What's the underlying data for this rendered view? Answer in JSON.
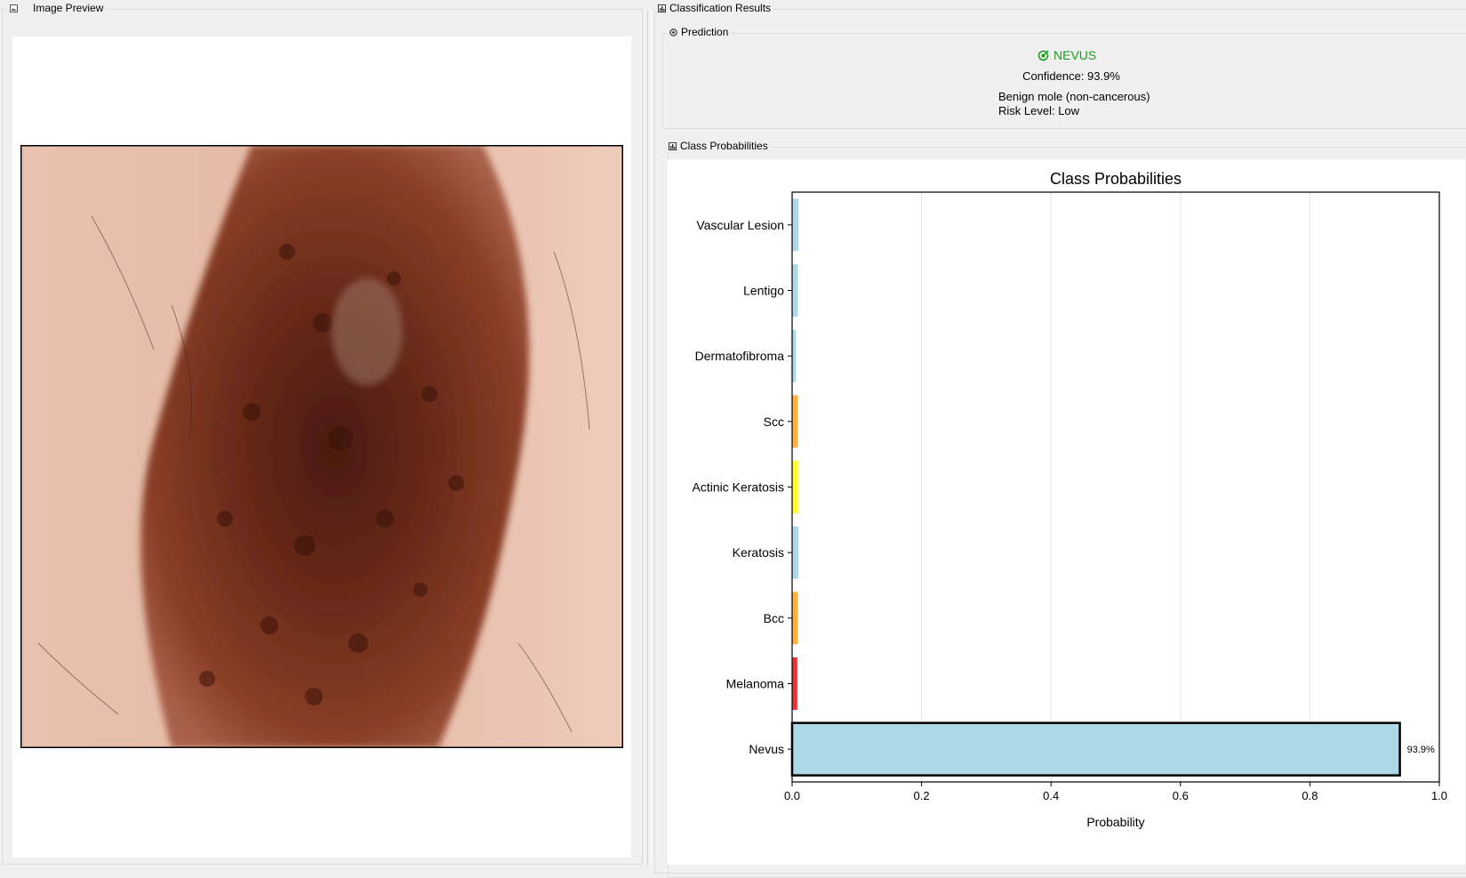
{
  "image_panel": {
    "title": "Image Preview",
    "title_icon": "image-icon"
  },
  "results_panel": {
    "title": "Classification Results",
    "title_icon": "panel-icon",
    "prediction_group": {
      "title": "Prediction",
      "title_icon": "target-icon",
      "class_icon": "target-check-icon",
      "class_name": "NEVUS",
      "class_color": "#1a9c1a",
      "confidence": "Confidence: 93.9%",
      "description": "Benign mole (non-cancerous)",
      "risk": "Risk Level: Low"
    },
    "probabilities_group": {
      "title": "Class Probabilities",
      "title_icon": "chart-icon"
    }
  },
  "chart_data": {
    "type": "bar",
    "orientation": "horizontal",
    "title": "Class Probabilities",
    "xlabel": "Probability",
    "ylabel": "",
    "xlim": [
      0,
      1.0
    ],
    "xticks": [
      "0.0",
      "0.2",
      "0.4",
      "0.6",
      "0.8",
      "1.0"
    ],
    "grid": "vertical",
    "categories": [
      "Nevus",
      "Melanoma",
      "Bcc",
      "Keratosis",
      "Actinic Keratosis",
      "Scc",
      "Dermatofibroma",
      "Lentigo",
      "Vascular Lesion"
    ],
    "values": [
      0.939,
      0.008,
      0.009,
      0.01,
      0.01,
      0.009,
      0.006,
      0.009,
      0.01
    ],
    "colors": [
      "#add8e6",
      "#e8333c",
      "#ffb040",
      "#add8e6",
      "#ffff33",
      "#ffb040",
      "#add8e6",
      "#add8e6",
      "#add8e6"
    ],
    "highlighted": "Nevus",
    "value_labels": [
      {
        "category": "Nevus",
        "text": "93.9%"
      }
    ]
  }
}
